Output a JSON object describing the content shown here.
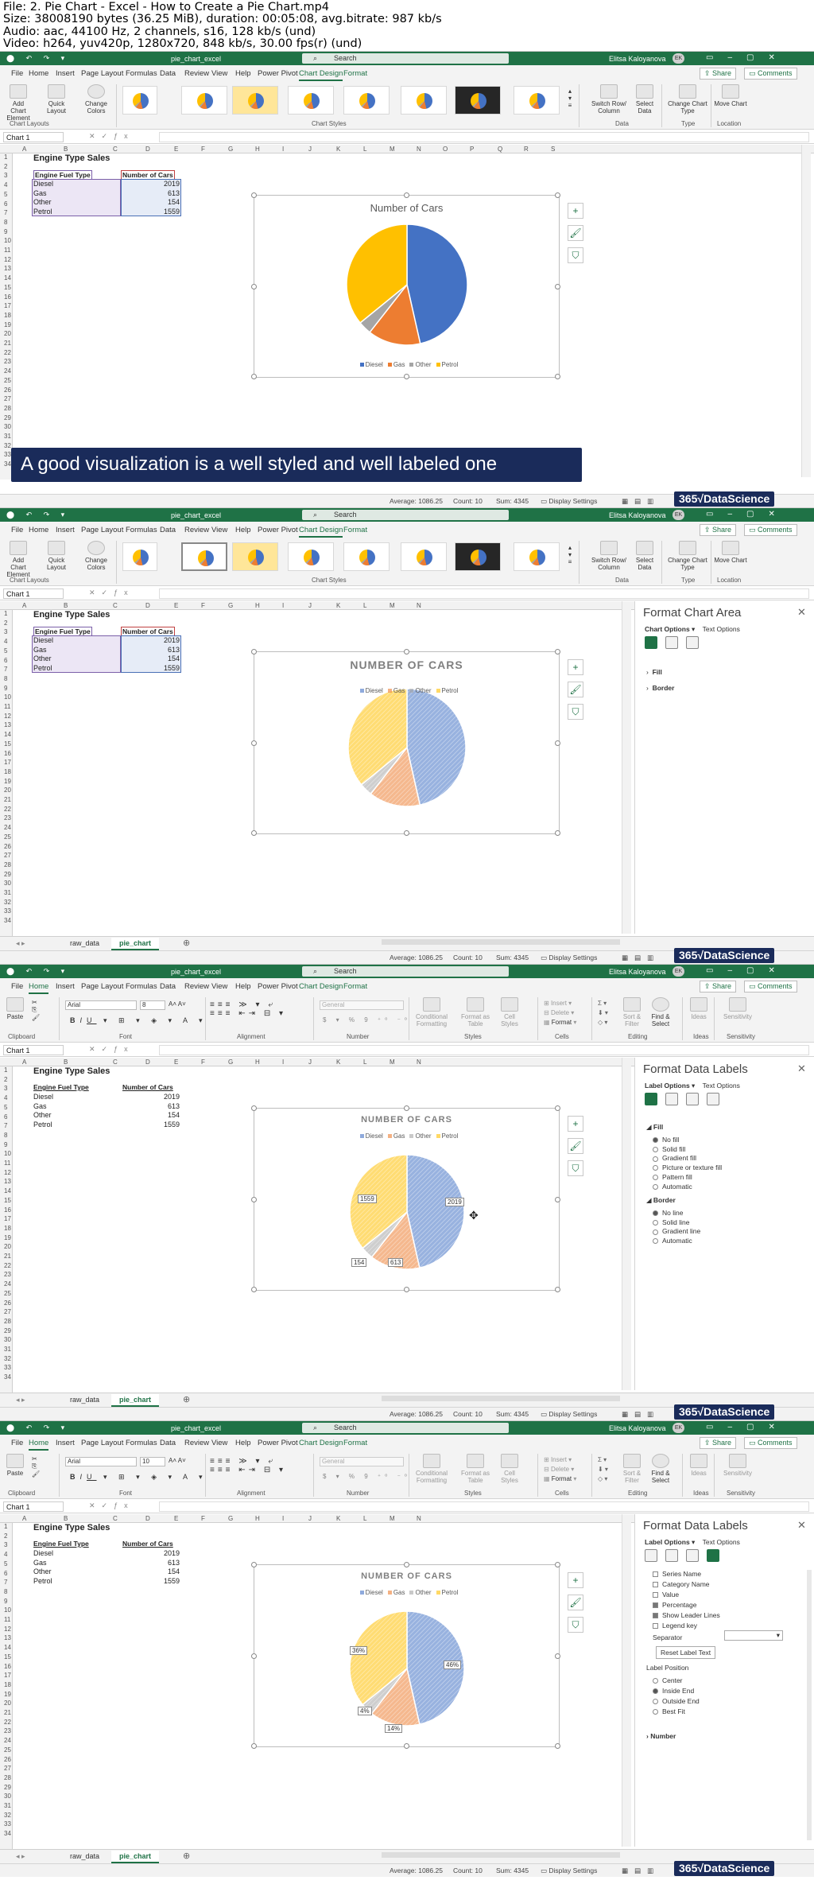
{
  "header": {
    "line1": "File: 2. Pie Chart - Excel - How to Create a Pie Chart.mp4",
    "line2": "Size: 38008190 bytes (36.25 MiB), duration: 00:05:08, avg.bitrate: 987 kb/s",
    "line3": "Audio: aac, 44100 Hz, 2 channels, s16, 128 kb/s (und)",
    "line4": "Video: h264, yuv420p, 1280x720, 848 kb/s, 30.00 fps(r) (und)"
  },
  "app": {
    "filename": "pie_chart_excel",
    "search": "Search",
    "user": "Elitsa Kaloyanova",
    "avatar": "EK",
    "namebox": "Chart 1",
    "share": "Share",
    "comments": "Comments"
  },
  "tabs": [
    "File",
    "Home",
    "Insert",
    "Page Layout",
    "Formulas",
    "Data",
    "Review",
    "View",
    "Help",
    "Power Pivot",
    "Chart Design",
    "Format"
  ],
  "ribbon_design": {
    "add_chart": "Add Chart Element",
    "quick_layout": "Quick Layout",
    "change_colors": "Change Colors",
    "switch": "Switch Row/ Column",
    "select_data": "Select Data",
    "change_type": "Change Chart Type",
    "move": "Move Chart",
    "g_layouts": "Chart Layouts",
    "g_styles": "Chart Styles",
    "g_data": "Data",
    "g_type": "Type",
    "g_location": "Location"
  },
  "ribbon_home": {
    "paste": "Paste",
    "font": "Arial",
    "size1": "8",
    "size2": "10",
    "general": "General",
    "cond": "Conditional Formatting",
    "format_table": "Format as Table",
    "cell_styles": "Cell Styles",
    "insert": "Insert",
    "delete": "Delete",
    "format": "Format",
    "sort": "Sort & Filter",
    "find": "Find & Select",
    "ideas": "Ideas",
    "sensitivity": "Sensitivity",
    "g_clipboard": "Clipboard",
    "g_font": "Font",
    "g_alignment": "Alignment",
    "g_number": "Number",
    "g_styles": "Styles",
    "g_cells": "Cells",
    "g_editing": "Editing",
    "g_ideas": "Ideas",
    "g_sensitivity": "Sensitivity"
  },
  "sheet": {
    "title": "Engine Type Sales",
    "h1": "Engine Fuel Type",
    "h2": "Number of Cars",
    "rows": [
      {
        "type": "Diesel",
        "n": "2019"
      },
      {
        "type": "Gas",
        "n": "613"
      },
      {
        "type": "Other",
        "n": "154"
      },
      {
        "type": "Petrol",
        "n": "1559"
      }
    ]
  },
  "chart": {
    "title1": "Number of Cars",
    "title2": "NUMBER OF CARS",
    "legend": [
      "Diesel",
      "Gas",
      "Other",
      "Petrol"
    ],
    "colors": [
      "#4472c4",
      "#ed7d31",
      "#a5a5a5",
      "#ffc000"
    ],
    "labels_values": [
      "2019",
      "613",
      "154",
      "1559"
    ],
    "labels_pct": [
      "46%",
      "14%",
      "4%",
      "36%"
    ]
  },
  "chart_data": {
    "type": "pie",
    "categories": [
      "Diesel",
      "Gas",
      "Other",
      "Petrol"
    ],
    "values": [
      2019,
      613,
      154,
      1559
    ],
    "title": "Number of Cars"
  },
  "overlay": "A good visualization is a well styled and well labeled one",
  "pane_area": {
    "title": "Format Chart Area",
    "opt1": "Chart Options",
    "opt2": "Text Options",
    "fill": "Fill",
    "border": "Border"
  },
  "pane_labels": {
    "title": "Format Data Labels",
    "opt1": "Label Options",
    "opt2": "Text Options",
    "fill": "Fill",
    "fill_opts": [
      "No fill",
      "Solid fill",
      "Gradient fill",
      "Picture or texture fill",
      "Pattern fill",
      "Automatic"
    ],
    "border": "Border",
    "border_opts": [
      "No line",
      "Solid line",
      "Gradient line",
      "Automatic"
    ],
    "contains": [
      "Series Name",
      "Category Name",
      "Value",
      "Percentage",
      "Show Leader Lines",
      "Legend key"
    ],
    "separator": "Separator",
    "reset": "Reset Label Text",
    "position": "Label Position",
    "positions": [
      "Center",
      "Inside End",
      "Outside End",
      "Best Fit"
    ],
    "number": "Number"
  },
  "sheets": [
    "raw_data",
    "pie_chart"
  ],
  "status": {
    "avg": "Average: 1086.25",
    "count": "Count: 10",
    "sum": "Sum: 4345",
    "display": "Display Settings"
  },
  "watermark": "365√DataScience"
}
